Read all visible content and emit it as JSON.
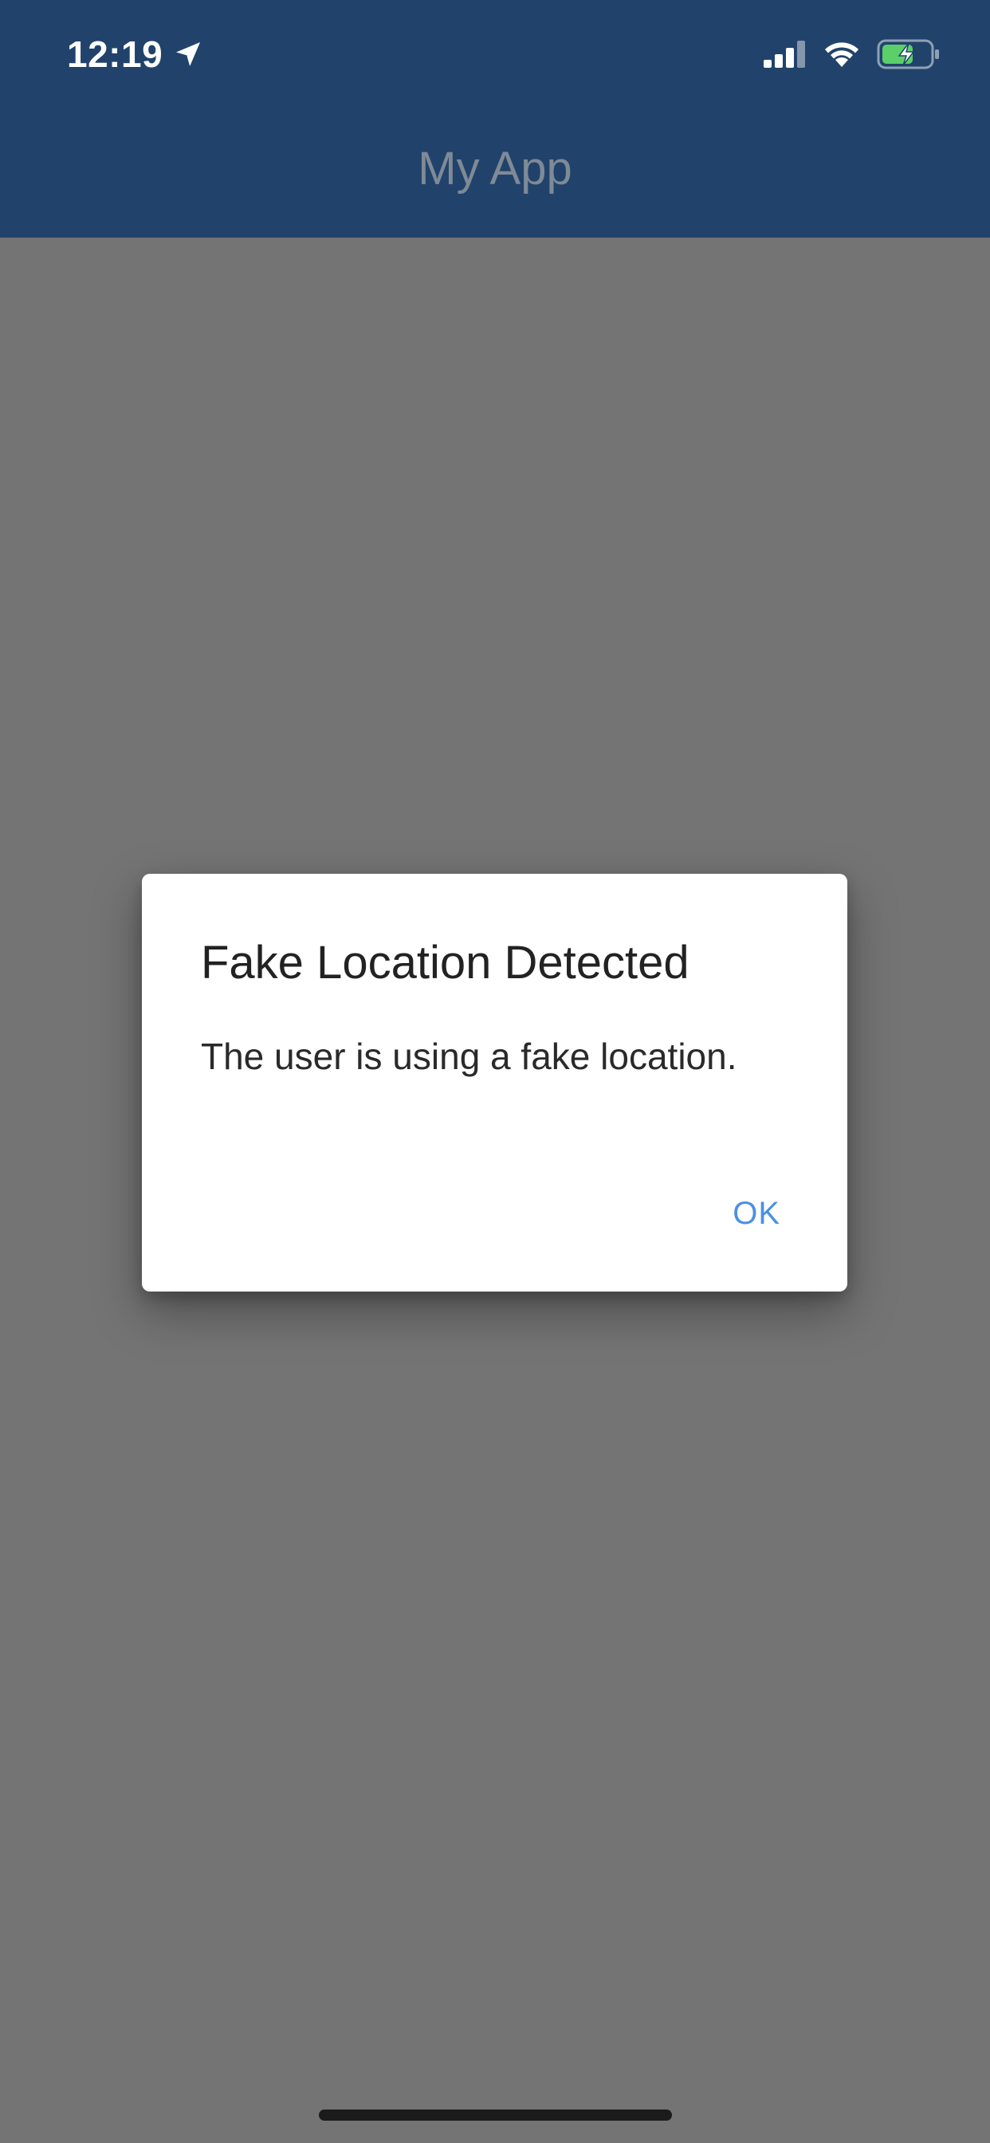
{
  "status_bar": {
    "time": "12:19",
    "location_icon": "location-arrow-icon",
    "signal_icon": "cellular-signal-icon",
    "wifi_icon": "wifi-icon",
    "battery_icon": "battery-charging-icon",
    "battery_color": "#5bd06a"
  },
  "app_bar": {
    "title": "My App",
    "background": "#21436b"
  },
  "dialog": {
    "title": "Fake Location Detected",
    "message": "The user is using a fake location.",
    "ok_label": "OK",
    "accent_color": "#4a90e2"
  }
}
